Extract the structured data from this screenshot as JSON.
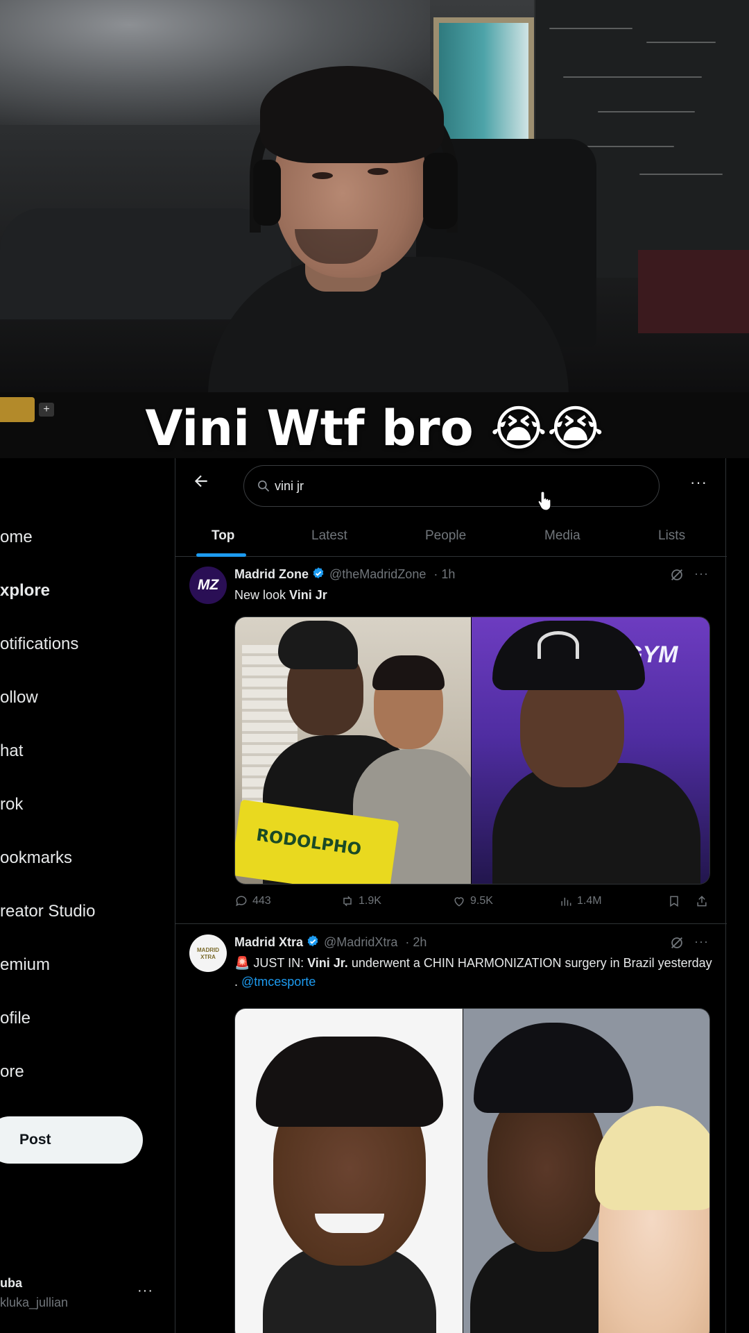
{
  "caption": {
    "text": "Vini Wtf bro 😭😭"
  },
  "overlay": {
    "plus_label": "+"
  },
  "sidebar": {
    "items": [
      {
        "label": "ome",
        "active": false
      },
      {
        "label": "xplore",
        "active": true
      },
      {
        "label": "otifications",
        "active": false
      },
      {
        "label": "ollow",
        "active": false
      },
      {
        "label": "hat",
        "active": false
      },
      {
        "label": "rok",
        "active": false
      },
      {
        "label": "ookmarks",
        "active": false
      },
      {
        "label": "reator Studio",
        "active": false
      },
      {
        "label": "emium",
        "active": false
      },
      {
        "label": "ofile",
        "active": false
      },
      {
        "label": "ore",
        "active": false
      }
    ],
    "post_label": "Post",
    "account": {
      "name": "uba",
      "handle": "kluka_jullian",
      "more": "···"
    }
  },
  "search": {
    "query": "vini jr",
    "more": "···"
  },
  "tabs": [
    {
      "label": "Top",
      "active": true
    },
    {
      "label": "Latest",
      "active": false
    },
    {
      "label": "People",
      "active": false
    },
    {
      "label": "Media",
      "active": false
    },
    {
      "label": "Lists",
      "active": false
    }
  ],
  "tweets": [
    {
      "name": "Madrid Zone",
      "handle": "@theMadridZone",
      "time": "· 1h",
      "avatar_text": "MZ",
      "text_prefix": "New look ",
      "text_bold": "Vini Jr",
      "text_suffix": "",
      "media_caption_left": "RODOLPHO",
      "media_caption_right": "GYM",
      "replies": "443",
      "reposts": "1.9K",
      "likes": "9.5K",
      "views": "1.4M",
      "more": "···"
    },
    {
      "name": "Madrid Xtra",
      "handle": "@MadridXtra",
      "time": "· 2h",
      "avatar_text": "MADRID XTRA",
      "text_emoji": "🚨",
      "text_prefix": " JUST IN: ",
      "text_bold": "Vini Jr.",
      "text_suffix": " underwent a CHIN HARMONIZATION surgery in Brazil yesterday . ",
      "text_link": "@tmcesporte",
      "more": "···"
    }
  ],
  "colors": {
    "accent": "#1d9bf0",
    "background": "#000000",
    "text": "#e7e9ea",
    "muted": "#71767b",
    "border": "#2f3336"
  }
}
